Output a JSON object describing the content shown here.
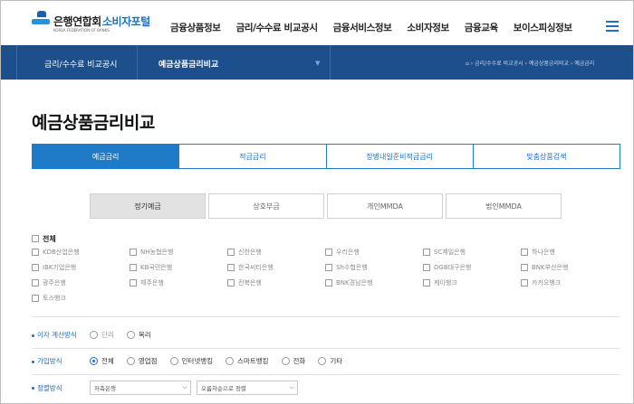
{
  "header": {
    "logo_name": "은행연합회",
    "logo_sub": "KOREA FEDERATION OF BANKS",
    "portal": "소비자포털",
    "nav": [
      "금융상품정보",
      "금리/수수료 비교공시",
      "금융서비스정보",
      "소비자정보",
      "금융교육",
      "보이스피싱정보"
    ],
    "menu_icon": "hamburger-icon"
  },
  "subbar": {
    "category": "금리/수수료 비교공시",
    "current": "예금상품금리비교",
    "breadcrumb": "⌂ › 금리/수수료 비교공시 › 예금상품금리비교 › 예금금리"
  },
  "page_title": "예금상품금리비교",
  "tabs": [
    "예금금리",
    "적금금리",
    "장병내일준비적금금리",
    "맞춤상품검색"
  ],
  "active_tab": 0,
  "subtabs": [
    "정기예금",
    "상호부금",
    "개인MMDA",
    "법인MMDA"
  ],
  "banks": {
    "all_label": "전체",
    "items": [
      "KDB산업은행",
      "NH농협은행",
      "신한은행",
      "우리은행",
      "SC제일은행",
      "하나은행",
      "IBK기업은행",
      "KB국민은행",
      "한국씨티은행",
      "Sh수협은행",
      "DGB대구은행",
      "BNK부산은행",
      "광주은행",
      "제주은행",
      "전북은행",
      "BNK경남은행",
      "케이뱅크",
      "카카오뱅크",
      "토스뱅크"
    ]
  },
  "options": {
    "interest_label": "이자 계산방식",
    "interest": [
      "단리",
      "복리"
    ],
    "join_label": "가입방식",
    "join": [
      "전체",
      "영업점",
      "인터넷뱅킹",
      "스마트뱅킹",
      "전화",
      "기타"
    ],
    "join_selected": 0,
    "sort_label": "정렬방식",
    "sort_field": "저축은행",
    "sort_order": "오름차순으로 정렬"
  }
}
